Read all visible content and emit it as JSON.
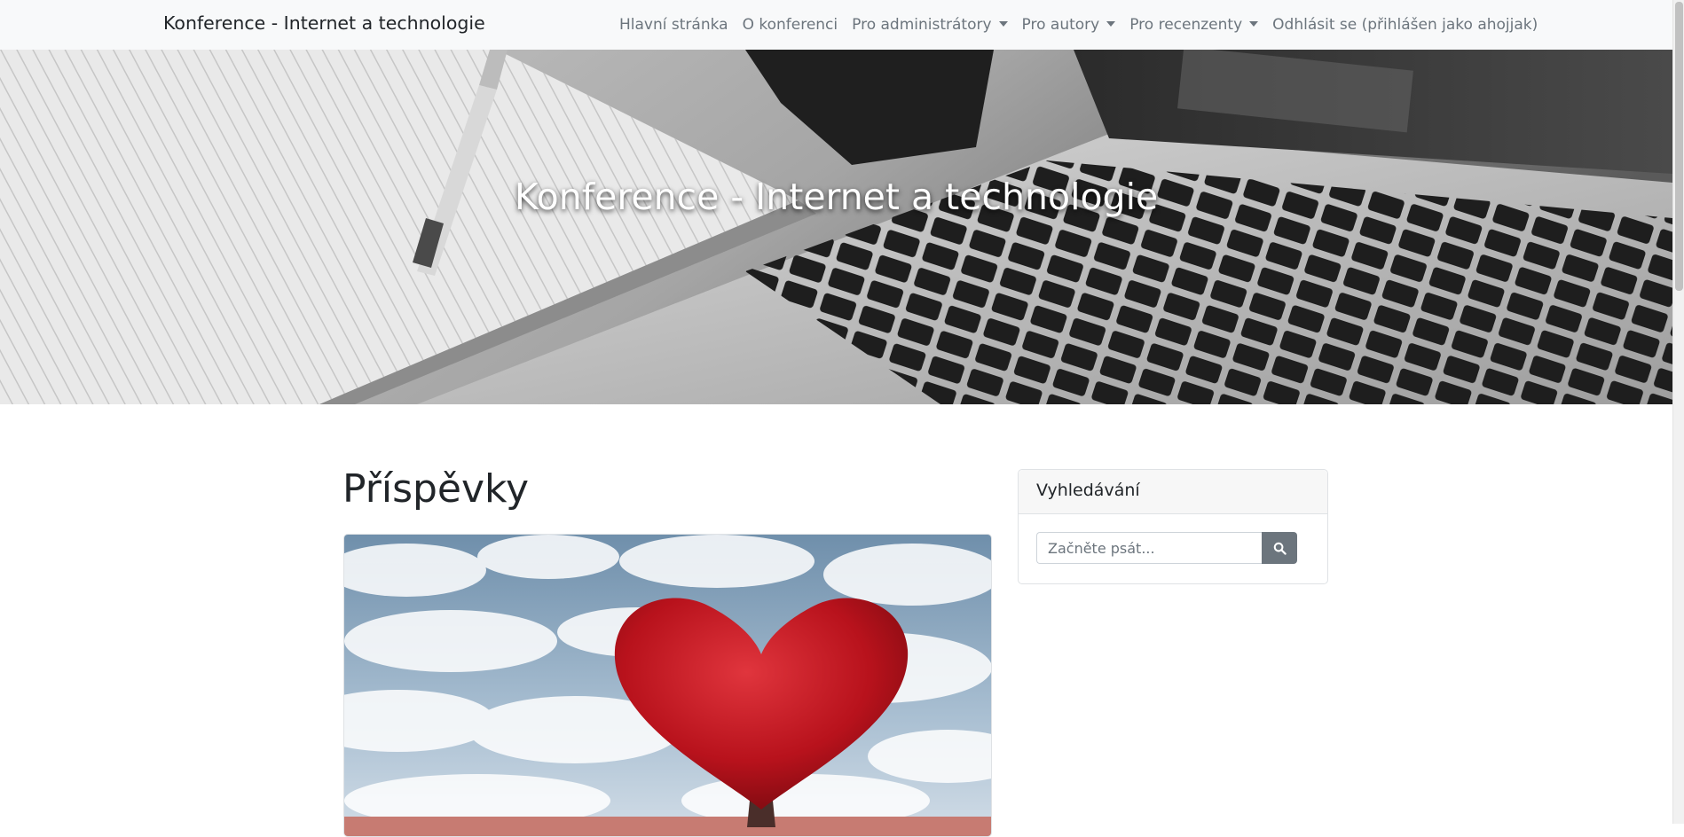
{
  "navbar": {
    "brand": "Konference - Internet a technologie",
    "links": [
      {
        "label": "Hlavní stránka"
      },
      {
        "label": "O konferenci"
      },
      {
        "label": "Pro administrátory"
      },
      {
        "label": "Pro autory"
      },
      {
        "label": "Pro recenzenty"
      },
      {
        "label": "Odhlásit se (přihlášen jako ahojjak)"
      }
    ]
  },
  "hero": {
    "title": "Konference - Internet a technologie"
  },
  "main": {
    "title": "Příspěvky"
  },
  "sidebar": {
    "search": {
      "header": "Vyhledávání",
      "placeholder": "Začněte psát...",
      "button_icon": "search-icon"
    }
  },
  "colors": {
    "navbar_bg": "#f8f9fa",
    "nav_link": "#6c757d",
    "button_secondary": "#6c757d",
    "card_header_bg": "#f7f7f7"
  }
}
